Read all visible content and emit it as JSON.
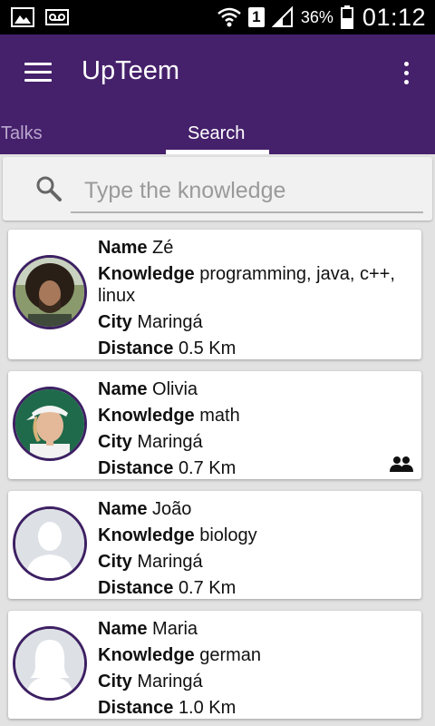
{
  "status_bar": {
    "icons": [
      "image-icon",
      "voicemail-icon",
      "wifi-icon",
      "signal-icon",
      "battery-icon"
    ],
    "sim_slot": "1",
    "battery": "36%",
    "time": "01:12"
  },
  "app_bar": {
    "title": "UpTeem",
    "color": "#45206b",
    "tabs": [
      {
        "label": "Talks",
        "selected": false
      },
      {
        "label": "Search",
        "selected": true
      }
    ]
  },
  "search": {
    "placeholder": "Type the knowledge",
    "value": ""
  },
  "labels": {
    "name": "Name",
    "knowledge": "Knowledge",
    "city": "City",
    "distance": "Distance"
  },
  "results": [
    {
      "name": "Zé",
      "knowledge": "programming, java, c++, linux",
      "city": "Maringá",
      "distance": "0.5 Km",
      "avatar": "photo-man-curly-hair",
      "group_icon": false
    },
    {
      "name": "Olivia",
      "knowledge": "math",
      "city": "Maringá",
      "distance": "0.7 Km",
      "avatar": "photo-woman-tennis-cap",
      "group_icon": true
    },
    {
      "name": "João",
      "knowledge": "biology",
      "city": "Maringá",
      "distance": "0.7 Km",
      "avatar": "default-male-silhouette",
      "group_icon": false
    },
    {
      "name": "Maria",
      "knowledge": "german",
      "city": "Maringá",
      "distance": "1.0 Km",
      "avatar": "default-female-silhouette",
      "group_icon": false
    }
  ]
}
